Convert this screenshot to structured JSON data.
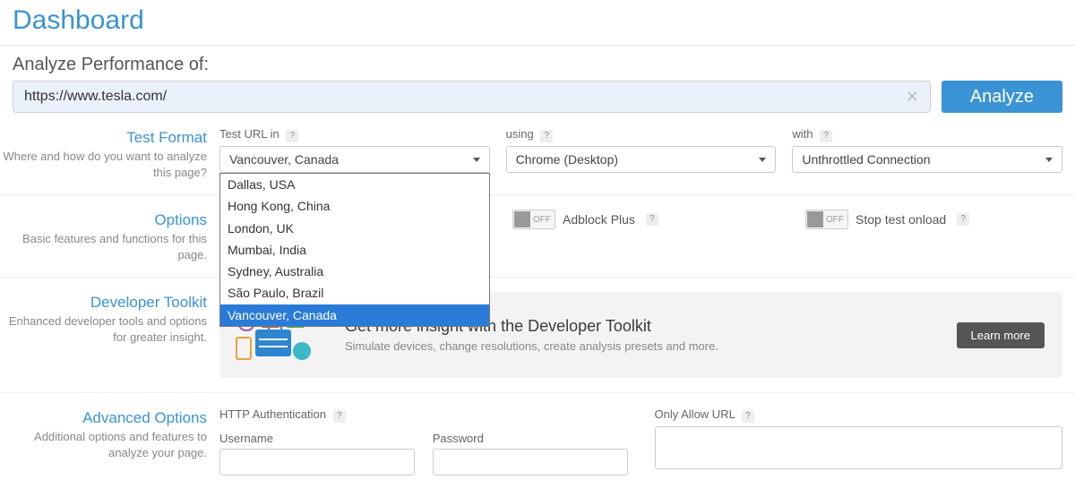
{
  "title": "Dashboard",
  "analyze": {
    "label": "Analyze Performance of:",
    "url_value": "https://www.tesla.com/",
    "button": "Analyze"
  },
  "test_format": {
    "heading": "Test Format",
    "sub": "Where and how do you want to analyze this page?",
    "location_label": "Test URL in",
    "location_selected": "Vancouver, Canada",
    "location_options": [
      "Dallas, USA",
      "Hong Kong, China",
      "London, UK",
      "Mumbai, India",
      "Sydney, Australia",
      "São Paulo, Brazil",
      "Vancouver, Canada"
    ],
    "browser_label": "using",
    "browser_selected": "Chrome (Desktop)",
    "connection_label": "with",
    "connection_selected": "Unthrottled Connection"
  },
  "options": {
    "heading": "Options",
    "sub": "Basic features and functions for this page.",
    "toggle_state": "OFF",
    "adblock_label": "Adblock Plus",
    "stop_onload_label": "Stop test onload"
  },
  "dev": {
    "heading": "Developer Toolkit",
    "sub": "Enhanced developer tools and options for greater insight.",
    "banner_title": "Get more insight with the Developer Toolkit",
    "banner_sub": "Simulate devices, change resolutions, create analysis presets and more.",
    "learn_more": "Learn more"
  },
  "advanced": {
    "heading": "Advanced Options",
    "sub": "Additional options and features to analyze your page.",
    "http_auth_label": "HTTP Authentication",
    "username_label": "Username",
    "password_label": "Password",
    "only_allow_label": "Only Allow URL"
  }
}
